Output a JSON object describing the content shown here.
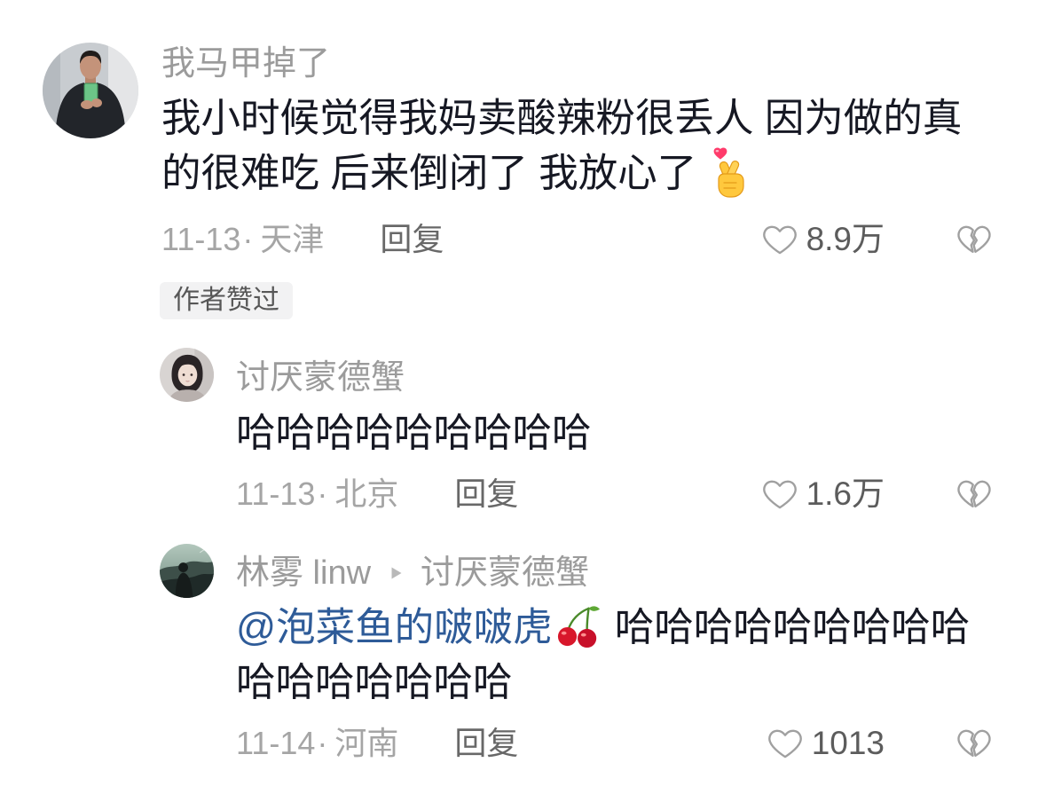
{
  "comment": {
    "username": "我马甲掉了",
    "text": "我小时候觉得我妈卖酸辣粉很丢人 因为做的真的很难吃 后来倒闭了 我放心了",
    "emoji_icon": "finger-heart-emoji-icon",
    "date": "11-13",
    "separator": "·",
    "location": "天津",
    "reply_label": "回复",
    "like_icon": "heart-outline-icon",
    "like_count": "8.9万",
    "dislike_icon": "broken-heart-icon",
    "badge": "作者赞过"
  },
  "replies": [
    {
      "username": "讨厌蒙德蟹",
      "text": "哈哈哈哈哈哈哈哈哈",
      "date": "11-13",
      "separator": "·",
      "location": "北京",
      "reply_label": "回复",
      "like_icon": "heart-outline-icon",
      "like_count": "1.6万",
      "dislike_icon": "broken-heart-icon"
    },
    {
      "username": "林雾 linw",
      "reply_arrow_icon": "reply-arrow-icon",
      "reply_to": "讨厌蒙德蟹",
      "mention": "@泡菜鱼的啵啵虎",
      "emoji_icon": "cherry-emoji-icon",
      "text": "哈哈哈哈哈哈哈哈哈哈哈哈哈哈哈哈",
      "date": "11-14",
      "separator": "·",
      "location": "河南",
      "reply_label": "回复",
      "like_icon": "heart-outline-icon",
      "like_count": "1013",
      "dislike_icon": "broken-heart-icon"
    }
  ],
  "colors": {
    "text": "#161823",
    "username": "#9b9b9b",
    "meta": "#a5a5a5",
    "reply": "#686868",
    "count": "#5c5c5c",
    "icon": "#a0a0a0",
    "mention": "#2e5b98",
    "badge_bg": "#f2f2f3",
    "badge_text": "#575757",
    "background": "#ffffff"
  }
}
